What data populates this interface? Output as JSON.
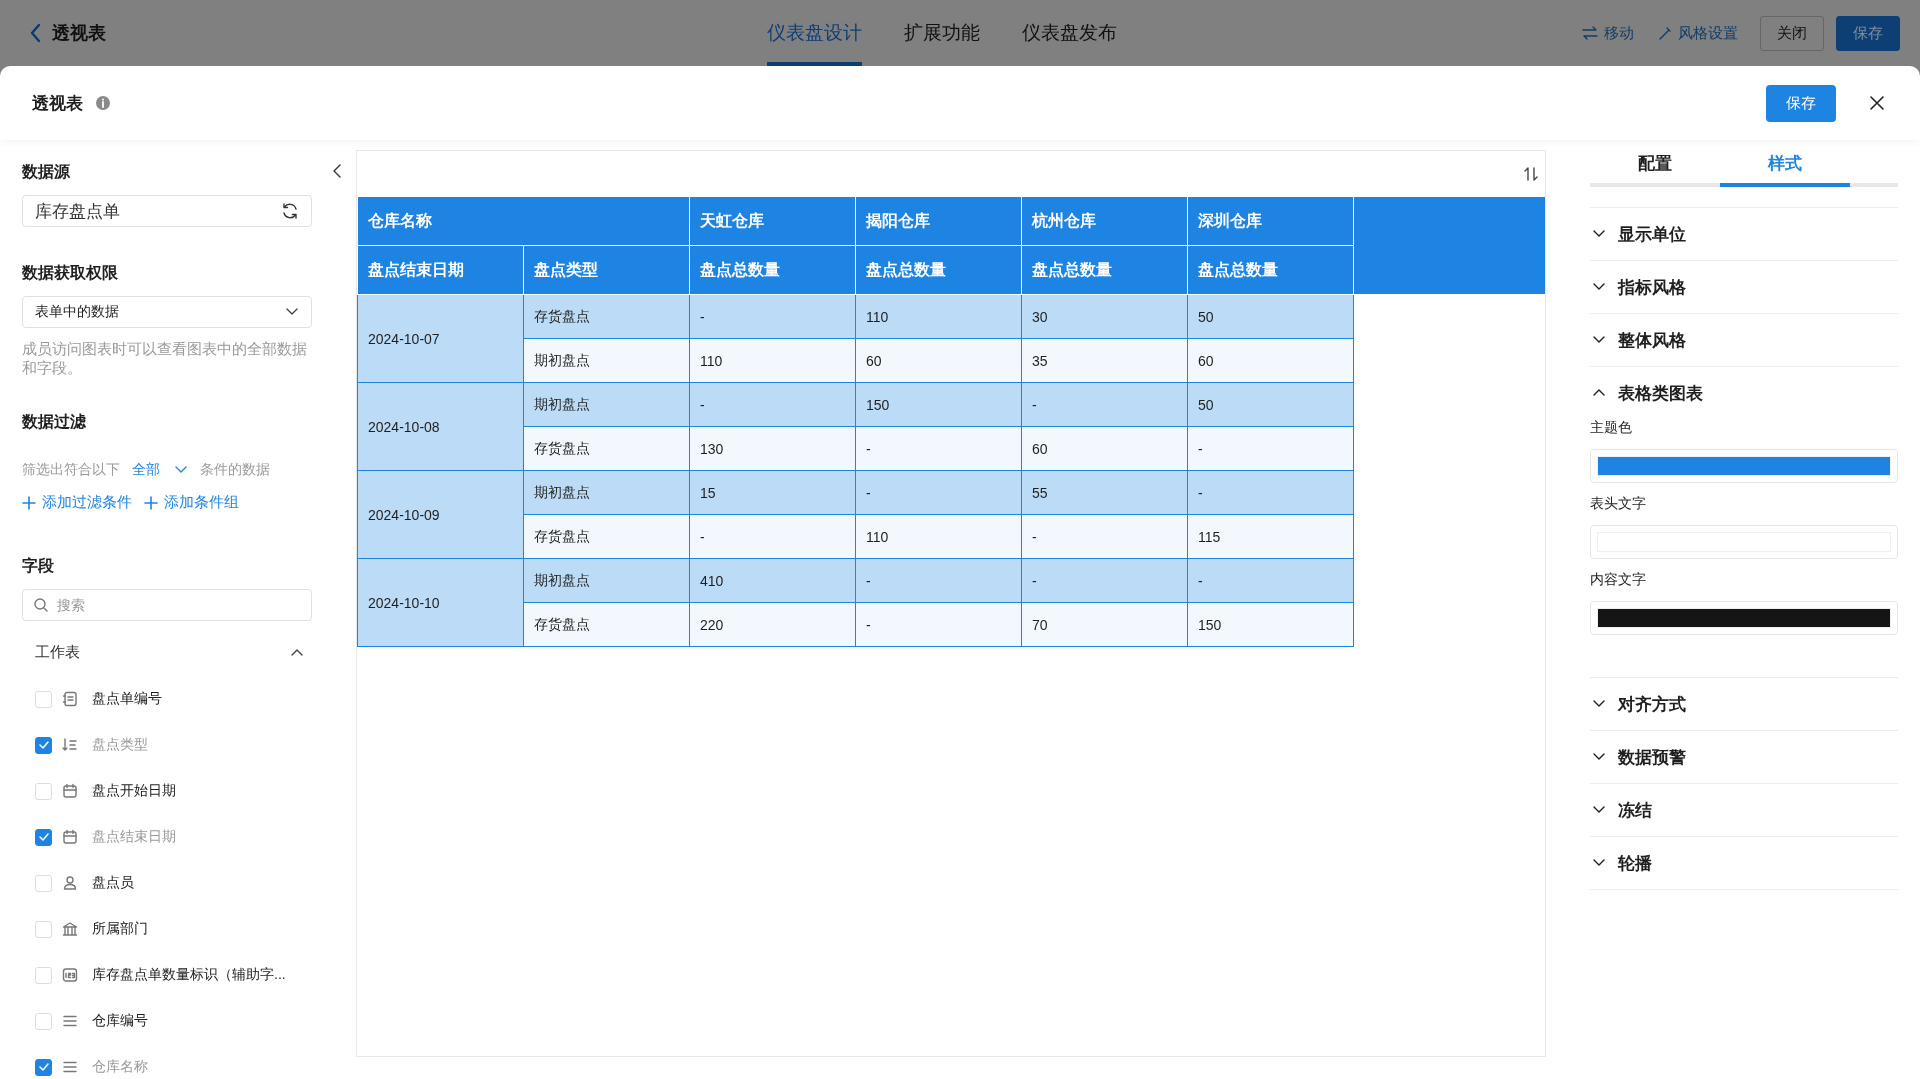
{
  "top_bar": {
    "back_label": "透视表",
    "tabs": [
      {
        "label": "仪表盘设计",
        "selected": true
      },
      {
        "label": "扩展功能",
        "selected": false
      },
      {
        "label": "仪表盘发布",
        "selected": false
      }
    ],
    "actions": [
      {
        "kind": "move",
        "label": "移动"
      },
      {
        "kind": "style",
        "label": "风格设置"
      },
      {
        "kind": "outline",
        "label": "关闭"
      },
      {
        "kind": "primary",
        "label": "保存"
      }
    ]
  },
  "dialog": {
    "title": "透视表",
    "save_label": "保存"
  },
  "data_panel": {
    "source_heading": "数据源",
    "source_value": "库存盘点单",
    "permission_heading": "数据获取权限",
    "permission_value": "表单中的数据",
    "permission_help": "成员访问图表时可以查看图表中的全部数据和字段。",
    "filter_heading": "数据过滤",
    "filter_prefix": "筛选出符合以下",
    "filter_mode": "全部",
    "filter_suffix": "条件的数据",
    "filter_links": [
      "添加过滤条件",
      "添加条件组"
    ],
    "fields_heading": "字段",
    "search_placeholder": "搜索",
    "group_label": "工作表",
    "group_expanded": true,
    "fields": [
      {
        "kind": "text-doc",
        "label": "盘点单编号",
        "checked": false
      },
      {
        "kind": "sort",
        "label": "盘点类型",
        "checked": true
      },
      {
        "kind": "date",
        "label": "盘点开始日期",
        "checked": false
      },
      {
        "kind": "date",
        "label": "盘点结束日期",
        "checked": true
      },
      {
        "kind": "person",
        "label": "盘点员",
        "checked": false
      },
      {
        "kind": "department",
        "label": "所属部门",
        "checked": false
      },
      {
        "kind": "number",
        "label": "库存盘点单数量标识（辅助字...",
        "checked": false
      },
      {
        "kind": "lines",
        "label": "仓库编号",
        "checked": false
      },
      {
        "kind": "lines",
        "label": "仓库名称",
        "checked": true
      }
    ]
  },
  "pivot_table": {
    "corner_label": "仓库名称",
    "warehouses": [
      "天虹仓库",
      "揭阳仓库",
      "杭州仓库",
      "深圳仓库"
    ],
    "row_headers": [
      "盘点结束日期",
      "盘点类型"
    ],
    "measure_headers": [
      "盘点总数量",
      "盘点总数量",
      "盘点总数量",
      "盘点总数量"
    ],
    "groups": [
      {
        "date": "2024-10-07",
        "rows": [
          {
            "type": "存货盘点",
            "values": [
              "-",
              "110",
              "30",
              "50"
            ]
          },
          {
            "type": "期初盘点",
            "values": [
              "110",
              "60",
              "35",
              "60"
            ]
          }
        ]
      },
      {
        "date": "2024-10-08",
        "rows": [
          {
            "type": "期初盘点",
            "values": [
              "-",
              "150",
              "-",
              "50"
            ]
          },
          {
            "type": "存货盘点",
            "values": [
              "130",
              "-",
              "60",
              "-"
            ]
          }
        ]
      },
      {
        "date": "2024-10-09",
        "rows": [
          {
            "type": "期初盘点",
            "values": [
              "15",
              "-",
              "55",
              "-"
            ]
          },
          {
            "type": "存货盘点",
            "values": [
              "-",
              "110",
              "-",
              "115"
            ]
          }
        ]
      },
      {
        "date": "2024-10-10",
        "rows": [
          {
            "type": "期初盘点",
            "values": [
              "410",
              "-",
              "-",
              "-"
            ]
          },
          {
            "type": "存货盘点",
            "values": [
              "220",
              "-",
              "70",
              "150"
            ]
          }
        ]
      }
    ]
  },
  "style_panel": {
    "tabs": [
      {
        "label": "配置",
        "selected": false
      },
      {
        "label": "样式",
        "selected": true
      }
    ],
    "sections": [
      {
        "label": "显示单位",
        "expanded": false
      },
      {
        "label": "指标风格",
        "expanded": false
      },
      {
        "label": "整体风格",
        "expanded": false
      },
      {
        "label": "表格类图表",
        "expanded": true,
        "colors": [
          {
            "label": "主题色",
            "color": "#1e84e3"
          },
          {
            "label": "表头文字",
            "color": "#ffffff"
          },
          {
            "label": "内容文字",
            "color": "#151515"
          }
        ]
      },
      {
        "label": "对齐方式",
        "expanded": false
      },
      {
        "label": "数据预警",
        "expanded": false
      },
      {
        "label": "冻结",
        "expanded": false
      },
      {
        "label": "轮播",
        "expanded": false
      }
    ]
  }
}
